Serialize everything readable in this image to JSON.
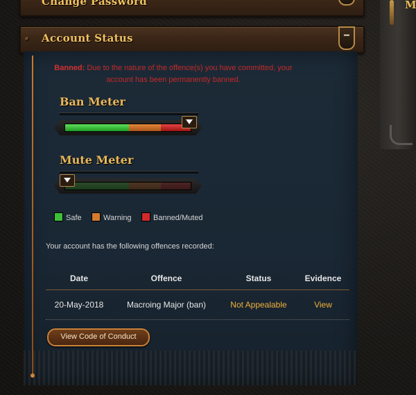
{
  "sections": {
    "change_password": {
      "title": "Change Password"
    },
    "account_status": {
      "title": "Account Status",
      "toggle_label": "−"
    }
  },
  "notice": {
    "prefix": "Banned:",
    "line1": " Due to the nature of the offence(s) you have committed, your",
    "line2": "account has been permanently banned."
  },
  "ban_meter": {
    "title": "Ban Meter",
    "level": "Banned"
  },
  "mute_meter": {
    "title": "Mute Meter",
    "level": "Safe"
  },
  "legend": [
    {
      "label": "Safe",
      "color": "#3cc03a"
    },
    {
      "label": "Warning",
      "color": "#d67a2e"
    },
    {
      "label": "Banned/Muted",
      "color": "#d12a2a"
    }
  ],
  "offences_intro": "Your account has the following offences recorded:",
  "table": {
    "headers": [
      "Date",
      "Offence",
      "Status",
      "Evidence"
    ],
    "rows": [
      {
        "date": "20-May-2018",
        "offence": "Macroing Major (ban)",
        "status": "Not Appealable",
        "evidence": "View"
      }
    ]
  },
  "buttons": {
    "code_of_conduct": "View Code of Conduct"
  },
  "side_panel": {
    "letter": "M"
  },
  "colors": {
    "accent": "#f0b13a",
    "title_gold": "#f0c061",
    "danger": "#c62828",
    "panel": "#1c2a37"
  }
}
